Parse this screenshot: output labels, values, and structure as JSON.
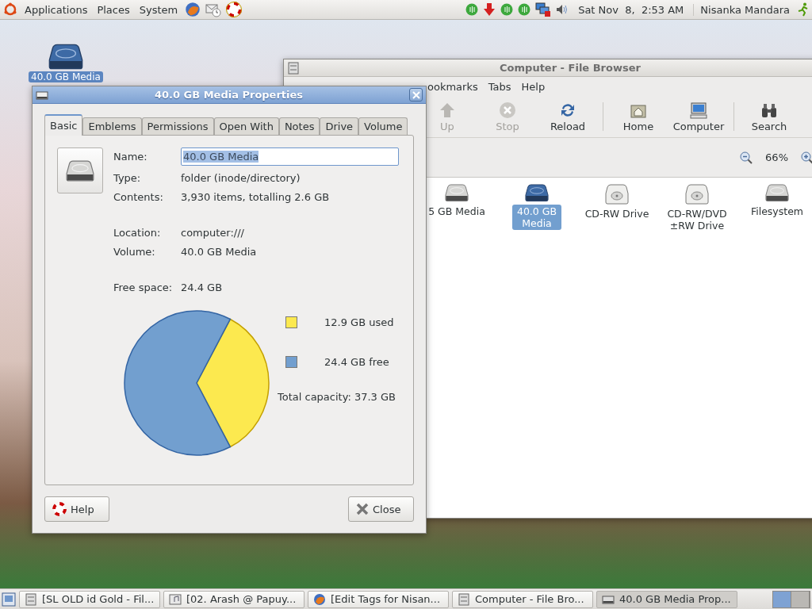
{
  "top_panel": {
    "menus": [
      {
        "label": "Applications",
        "kind": "apps"
      },
      {
        "label": "Places",
        "kind": "plain"
      },
      {
        "label": "System",
        "kind": "plain"
      }
    ],
    "clock": "Sat Nov  8,  2:53 AM",
    "user": "Nisanka Mandara"
  },
  "desktop": {
    "icons": [
      {
        "label": "40.0 GB Media"
      }
    ]
  },
  "file_browser": {
    "title": "Computer - File Browser",
    "menu": [
      "ookmarks",
      "Tabs",
      "Help"
    ],
    "toolbar_groups": [
      {
        "buttons": [
          {
            "label": "Up",
            "kind": "up",
            "disabled": true
          },
          {
            "label": "Stop",
            "kind": "stop",
            "disabled": true
          },
          {
            "label": "Reload",
            "kind": "reload",
            "disabled": false
          }
        ]
      },
      {
        "buttons": [
          {
            "label": "Home",
            "kind": "home",
            "disabled": false
          },
          {
            "label": "Computer",
            "kind": "computer",
            "disabled": false
          }
        ]
      },
      {
        "buttons": [
          {
            "label": "Search",
            "kind": "search",
            "disabled": false
          }
        ]
      }
    ],
    "zoom": "66%",
    "items": [
      {
        "label": "5 GB Media",
        "kind": "disk",
        "selected": false
      },
      {
        "label": "40.0 GB Media",
        "kind": "disk",
        "selected": true
      },
      {
        "label": "CD-RW Drive",
        "kind": "optical",
        "selected": false
      },
      {
        "label": "CD-RW/DVD ±RW Drive",
        "kind": "optical",
        "selected": false
      },
      {
        "label": "Filesystem",
        "kind": "disk",
        "selected": false
      }
    ]
  },
  "dialog": {
    "title": "40.0 GB Media Properties",
    "tabs": [
      {
        "label": "Basic",
        "selected": true
      },
      {
        "label": "Emblems",
        "selected": false
      },
      {
        "label": "Permissions",
        "selected": false
      },
      {
        "label": "Open With",
        "selected": false
      },
      {
        "label": "Notes",
        "selected": false
      },
      {
        "label": "Drive",
        "selected": false
      },
      {
        "label": "Volume",
        "selected": false
      }
    ],
    "name": {
      "label": "Name:",
      "value": "40.0 GB Media",
      "text_selected": true
    },
    "sections": [
      [
        {
          "label": "Type:",
          "value": "folder (inode/directory)"
        },
        {
          "label": "Contents:",
          "value": "3,930 items, totalling 2.6 GB"
        }
      ],
      [
        {
          "label": "Location:",
          "value": "computer:///"
        },
        {
          "label": "Volume:",
          "value": "40.0 GB Media"
        }
      ],
      [
        {
          "label": "Free space:",
          "value": "24.4 GB"
        }
      ]
    ],
    "usage": {
      "chart_data": {
        "type": "pie",
        "categories": [
          "12.9 GB used",
          "24.4 GB free"
        ],
        "values": [
          12.9,
          24.4
        ]
      },
      "legend": [
        {
          "color": "#fce94f"
        },
        {
          "color": "#729fcf"
        }
      ],
      "total": "Total capacity: 37.3 GB"
    },
    "buttons": [
      {
        "label": "Help",
        "kind": "help"
      },
      {
        "label": "Close",
        "kind": "close"
      }
    ]
  },
  "taskbar": {
    "tasks": [
      {
        "label": "[SL OLD id Gold - Fil...",
        "kind": "folder",
        "selected": false
      },
      {
        "label": "[02. Arash @ Papuy...",
        "kind": "music",
        "selected": false
      },
      {
        "label": "[Edit Tags for Nisan...",
        "kind": "browser",
        "selected": false
      },
      {
        "label": "Computer - File Bro...",
        "kind": "folder",
        "selected": false
      },
      {
        "label": "40.0 GB Media Prop...",
        "kind": "drive",
        "selected": true
      }
    ]
  }
}
